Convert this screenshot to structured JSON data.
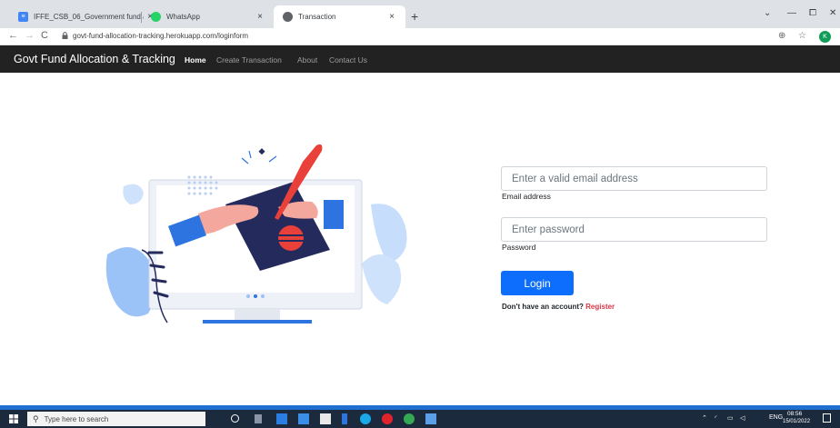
{
  "browser": {
    "tabs": [
      {
        "title": "IFFE_CSB_06_Government fund a...",
        "close": "×",
        "active": false
      },
      {
        "title": "WhatsApp",
        "close": "×",
        "active": false
      },
      {
        "title": "Transaction",
        "close": "×",
        "active": true
      }
    ],
    "new_tab": "+",
    "window_controls": {
      "menu": "⌄",
      "minimize": "—",
      "restore": "⧠",
      "close": "✕"
    },
    "nav": {
      "back": "←",
      "forward": "→",
      "reload": "C"
    },
    "url": "govt-fund-allocation-tracking.herokuapp.com/loginform",
    "profile_initial": "K"
  },
  "site": {
    "brand": "Govt Fund Allocation & Tracking",
    "nav": [
      {
        "label": "Home",
        "active": true
      },
      {
        "label": "Create Transaction",
        "active": false
      },
      {
        "label": "About",
        "active": false
      },
      {
        "label": "Contact Us",
        "active": false
      }
    ]
  },
  "form": {
    "email_placeholder": "Enter a valid email address",
    "email_value": "",
    "email_label": "Email address",
    "password_placeholder": "Enter password",
    "password_value": "",
    "password_label": "Password",
    "login_label": "Login",
    "register_prompt": "Don't have an account?",
    "register_link": "Register"
  },
  "taskbar": {
    "search_placeholder": "Type here to search",
    "lang": "ENG",
    "time": "08:56",
    "date": "15/01/2022"
  },
  "colors": {
    "navbar": "#222222",
    "primary": "#0d6efd",
    "register": "#dc3545",
    "illustration_accent": "#e9403a",
    "illustration_navy": "#252a5c",
    "illustration_blue": "#2d74e0"
  }
}
